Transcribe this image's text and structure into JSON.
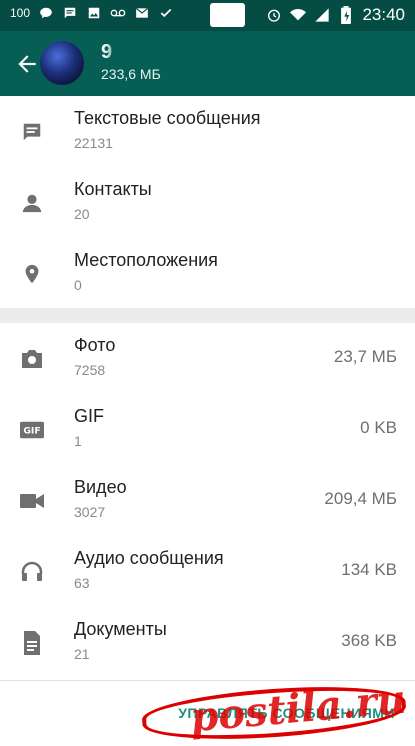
{
  "statusbar": {
    "left_number": "100",
    "icons_left": [
      "speech-bubble-icon",
      "message-icon",
      "image-icon",
      "voicemail-icon",
      "mail-icon",
      "check-icon"
    ],
    "time": "23:40",
    "icons_right": [
      "alarm-icon",
      "wifi-icon",
      "signal-icon",
      "battery-icon"
    ]
  },
  "appbar": {
    "contact_name": "9",
    "storage_size": "233,6 МБ"
  },
  "items_group1": [
    {
      "icon": "message-icon",
      "title": "Текстовые сообщения",
      "count": "22131"
    },
    {
      "icon": "person-icon",
      "title": "Контакты",
      "count": "20"
    },
    {
      "icon": "location-pin-icon",
      "title": "Местоположения",
      "count": "0"
    }
  ],
  "items_group2": [
    {
      "icon": "camera-icon",
      "title": "Фото",
      "count": "7258",
      "size": "23,7 МБ"
    },
    {
      "icon": "gif-icon",
      "title": "GIF",
      "count": "1",
      "size": "0 KB"
    },
    {
      "icon": "video-camera-icon",
      "title": "Видео",
      "count": "3027",
      "size": "209,4 МБ"
    },
    {
      "icon": "headphones-icon",
      "title": "Аудио сообщения",
      "count": "63",
      "size": "134 KB"
    },
    {
      "icon": "document-icon",
      "title": "Документы",
      "count": "21",
      "size": "368 KB"
    }
  ],
  "bottom": {
    "manage_label": "УПРАВЛЯТЬ СООБЩЕНИЯМИ"
  },
  "watermark": {
    "text": "postila.ru"
  },
  "colors": {
    "statusbar": "#054d44",
    "appbar": "#075e54",
    "accent": "#1e8f7c",
    "icon_gray": "#6f6f6f",
    "stamp": "#dd0000"
  }
}
